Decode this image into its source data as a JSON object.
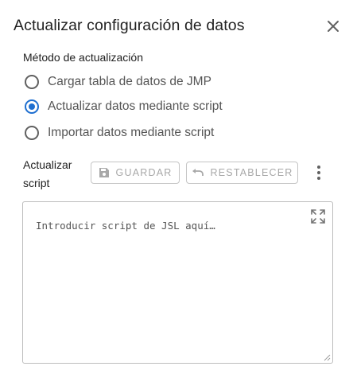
{
  "dialog": {
    "title": "Actualizar configuración de datos",
    "close_icon": "close-icon"
  },
  "method": {
    "label": "Método de actualización",
    "options": [
      {
        "label": "Cargar tabla de datos de JMP",
        "selected": false
      },
      {
        "label": "Actualizar datos mediante script",
        "selected": true
      },
      {
        "label": "Importar datos mediante script",
        "selected": false
      }
    ]
  },
  "script": {
    "label_line1": "Actualizar",
    "label_line2": "script",
    "save_label": "GUARDAR",
    "reset_label": "RESTABLECER",
    "save_icon": "save-icon",
    "reset_icon": "undo-icon",
    "more_icon": "more-vert-icon",
    "placeholder": "Introducir script de JSL aquí…",
    "expand_icon": "fullscreen-icon"
  },
  "colors": {
    "accent": "#1e6fd0",
    "disabled_text": "#a8a8a8",
    "border": "#c4c4c4"
  }
}
